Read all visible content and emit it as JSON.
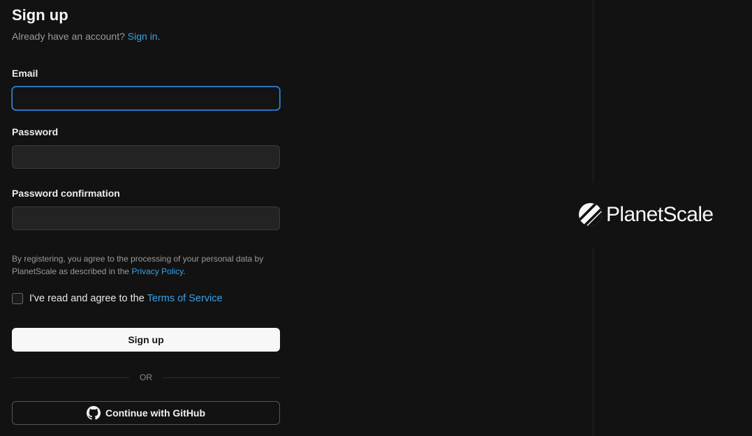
{
  "header": {
    "title": "Sign up",
    "subtitle_prefix": "Already have an account?",
    "signin_link": "Sign in",
    "subtitle_suffix": "."
  },
  "form": {
    "email_label": "Email",
    "email_value": "",
    "password_label": "Password",
    "password_value": "",
    "confirmation_label": "Password confirmation",
    "confirmation_value": ""
  },
  "legal": {
    "text": "By registering, you agree to the processing of your personal data by PlanetScale as described in the",
    "privacy_link": "Privacy Policy",
    "suffix": "."
  },
  "terms": {
    "checked": false,
    "label_prefix": "I've read and agree to the",
    "terms_link": "Terms of Service"
  },
  "actions": {
    "signup_label": "Sign up",
    "divider_label": "OR",
    "github_label": "Continue with GitHub",
    "github_icon": "github-icon"
  },
  "brand": {
    "logo_text": "PlanetScale",
    "logo_icon": "planetscale-logo-mark"
  },
  "colors": {
    "background": "#121212",
    "link": "#3ba1e6",
    "focus_border": "#3d86d6",
    "primary_button": "#f7f7f7"
  }
}
